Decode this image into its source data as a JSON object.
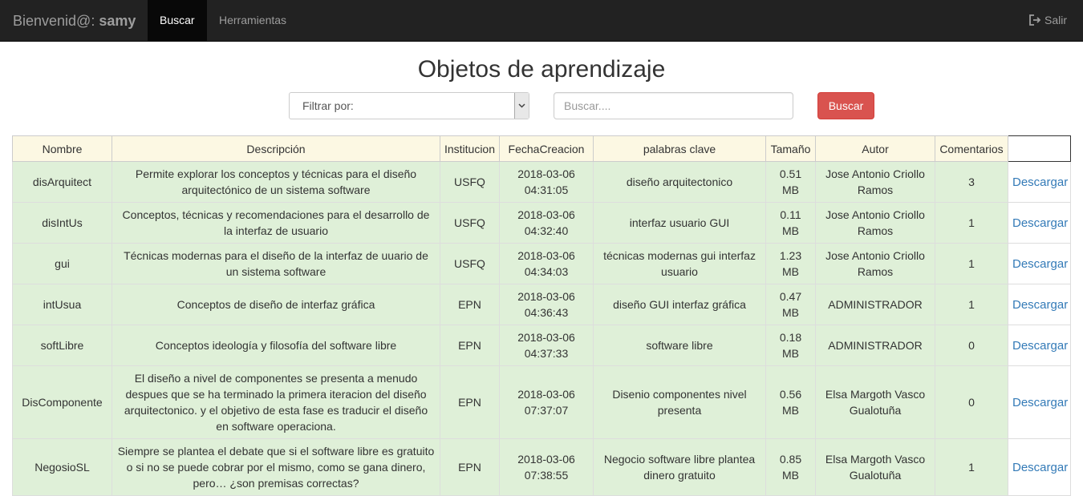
{
  "navbar": {
    "brand_prefix": "Bienvenid@: ",
    "brand_user": "samy",
    "items": [
      {
        "label": "Buscar",
        "active": true
      },
      {
        "label": "Herramientas",
        "active": false
      }
    ],
    "logout_label": "Salir",
    "logout_icon": "logout-icon"
  },
  "page": {
    "title": "Objetos de aprendizaje"
  },
  "search": {
    "filter_label": "Filtrar por:",
    "placeholder": "Buscar....",
    "button_label": "Buscar"
  },
  "table": {
    "headers": [
      "Nombre",
      "Descripción",
      "Institucion",
      "FechaCreacion",
      "palabras clave",
      "Tamaño",
      "Autor",
      "Comentarios",
      ""
    ],
    "download_label": "Descargar",
    "rows": [
      {
        "nombre": "disArquitect",
        "descripcion": "Permite explorar los conceptos y técnicas para el diseño arquitectónico de un sistema software",
        "institucion": "USFQ",
        "fecha": "2018-03-06 04:31:05",
        "palabras": "diseño arquitectonico",
        "tamano": "0.51 MB",
        "autor": "Jose Antonio Criollo Ramos",
        "comentarios": "3"
      },
      {
        "nombre": "disIntUs",
        "descripcion": "Conceptos, técnicas y recomendaciones para el desarrollo de la interfaz de usuario",
        "institucion": "USFQ",
        "fecha": "2018-03-06 04:32:40",
        "palabras": "interfaz usuario GUI",
        "tamano": "0.11 MB",
        "autor": "Jose Antonio Criollo Ramos",
        "comentarios": "1"
      },
      {
        "nombre": "gui",
        "descripcion": "Técnicas modernas para el diseño de la interfaz de uuario de un sistema software",
        "institucion": "USFQ",
        "fecha": "2018-03-06 04:34:03",
        "palabras": "técnicas modernas gui interfaz usuario",
        "tamano": "1.23 MB",
        "autor": "Jose Antonio Criollo Ramos",
        "comentarios": "1"
      },
      {
        "nombre": "intUsua",
        "descripcion": "Conceptos de diseño de interfaz gráfica",
        "institucion": "EPN",
        "fecha": "2018-03-06 04:36:43",
        "palabras": "diseño GUI interfaz gráfica",
        "tamano": "0.47 MB",
        "autor": "ADMINISTRADOR",
        "comentarios": "1"
      },
      {
        "nombre": "softLibre",
        "descripcion": "Conceptos ideología y filosofía del software libre",
        "institucion": "EPN",
        "fecha": "2018-03-06 04:37:33",
        "palabras": "software libre",
        "tamano": "0.18 MB",
        "autor": "ADMINISTRADOR",
        "comentarios": "0"
      },
      {
        "nombre": "DisComponente",
        "descripcion": "El diseño a nivel de componentes se presenta a menudo despues que se ha terminado la primera iteracion del diseño arquitectonico. y el objetivo de esta fase es traducir el diseño en software operaciona.",
        "institucion": "EPN",
        "fecha": "2018-03-06 07:37:07",
        "palabras": "Disenio componentes nivel presenta",
        "tamano": "0.56 MB",
        "autor": "Elsa Margoth Vasco Gualotuña",
        "comentarios": "0"
      },
      {
        "nombre": "NegosioSL",
        "descripcion": "Siempre se plantea el debate que si el software libre es gratuito o si no se puede cobrar por el mismo, como se gana dinero, pero… ¿son premisas correctas?",
        "institucion": "EPN",
        "fecha": "2018-03-06 07:38:55",
        "palabras": "Negocio software libre plantea dinero gratuito",
        "tamano": "0.85 MB",
        "autor": "Elsa Margoth Vasco Gualotuña",
        "comentarios": "1"
      }
    ]
  },
  "colors": {
    "navbar_bg": "#222222",
    "header_bg": "#fcf8e3",
    "row_bg": "#dff0d8",
    "button_danger": "#d9534f",
    "link": "#337ab7"
  }
}
